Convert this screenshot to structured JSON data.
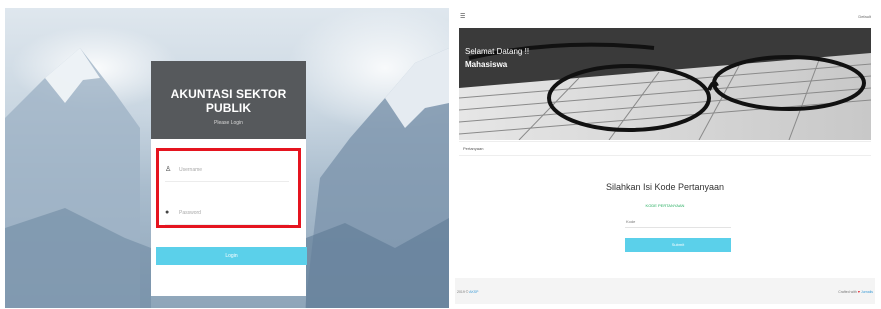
{
  "login": {
    "title": "AKUNTASI SEKTOR PUBLIK",
    "subtitle": "Please Login",
    "username_placeholder": "Username",
    "password_placeholder": "Password",
    "login_button": "Login",
    "user_icon": "user-icon",
    "lock_icon": "lock-icon"
  },
  "dashboard": {
    "menu_icon": "hamburger-icon",
    "user_link": "Default",
    "greeting": "Selamat Datang !!",
    "role": "Mahasiswa",
    "section_label": "Pertanyaan",
    "card_title": "Silahkan Isi Kode Pertanyaan",
    "code_label": "KODE PERTANYAAN",
    "code_placeholder": "Kode",
    "submit_button": "Submit",
    "footer_left_prefix": "2019 ©",
    "footer_left_link": "AKSP",
    "footer_right_prefix": "Crafted with",
    "footer_right_link": "Jurnalis"
  },
  "colors": {
    "header_dark": "#56595c",
    "highlight_red": "#e5141f",
    "accent_cyan": "#5bd0ea",
    "accent_green": "#27ae60"
  }
}
